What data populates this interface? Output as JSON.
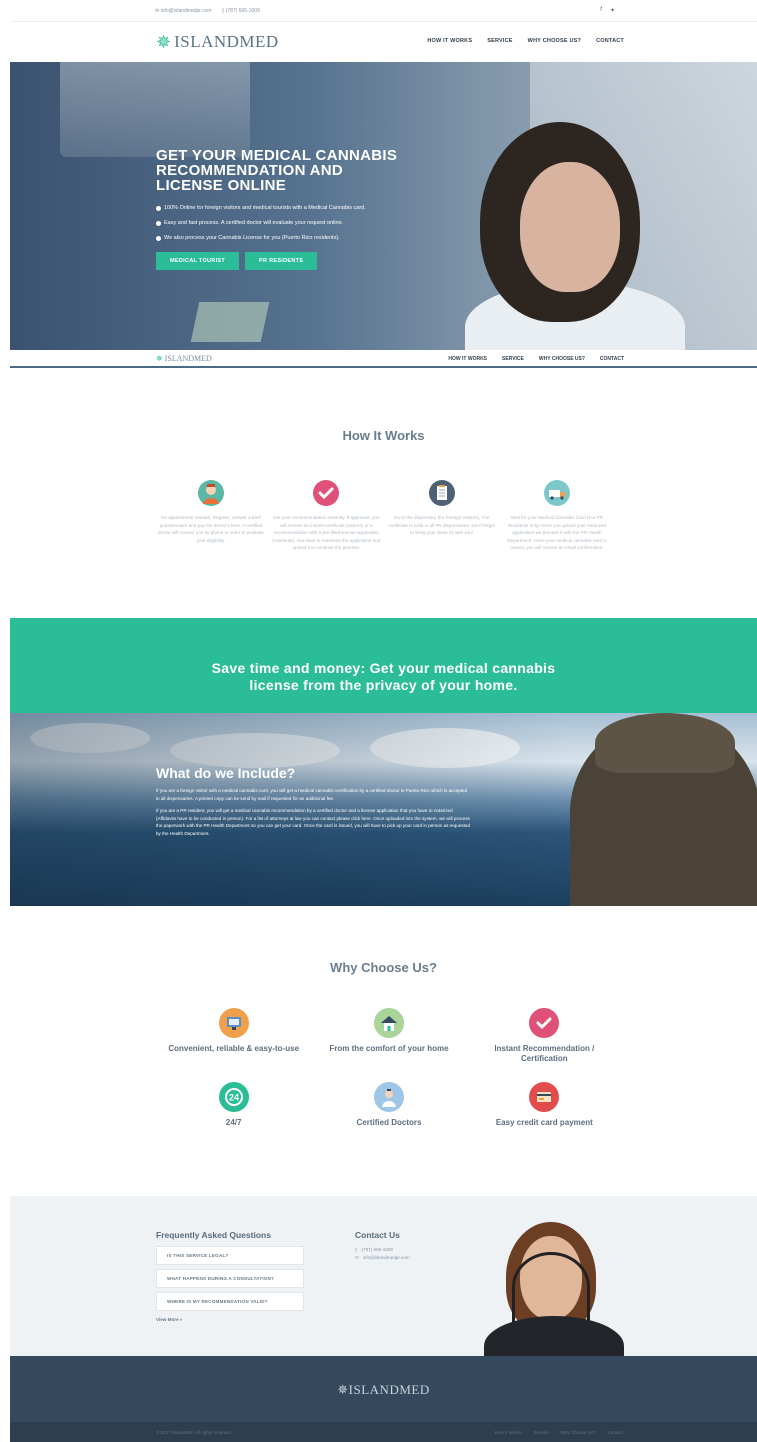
{
  "topbar": {
    "email": "info@islandmedpr.com",
    "phone": "(787) 665-1009",
    "social": [
      "f",
      "❧"
    ]
  },
  "header": {
    "logo_text": "ISLANDMED",
    "nav": [
      "HOW IT WORKS",
      "SERVICE",
      "WHY CHOOSE US?",
      "CONTACT"
    ]
  },
  "hero": {
    "title_lines": [
      "GET YOUR MEDICAL CANNABIS",
      "RECOMMENDATION AND",
      "LICENSE ONLINE"
    ],
    "bullets": [
      "100% Online for foreign visitors and medical tourists with a Medical Cannabis card.",
      "Easy and fast process. A certified doctor will evaluate your request online.",
      "We also process your Cannabis License for you (Puerto Rico residents)."
    ],
    "buttons": [
      "MEDICAL TOURIST",
      "PR RESIDENTS"
    ]
  },
  "sticky": {
    "logo_text": "ISLANDMED",
    "nav": [
      "HOW IT WORKS",
      "SERVICE",
      "WHY CHOOSE US?",
      "CONTACT"
    ]
  },
  "how": {
    "title": "How It Works",
    "steps": [
      {
        "icon": "doctor-icon",
        "color": "#5bb7a6",
        "text": "No appointment needed. Register, answer a brief questionnaire and pay the doctor's fees. A certified doctor will contact you by phone in order to evaluate your eligibility."
      },
      {
        "icon": "checkmark-icon",
        "color": "#e0517a",
        "text": "Get your recommendation instantly. If approved, you will receive an instant certificate (visitors) or a recommendation with a pre-filled license application (residents). You have to notarized the application and upload it to continue the process."
      },
      {
        "icon": "clipboard-icon",
        "color": "#4d6277",
        "text": "Go to the dispensary (for Foreign Visitors). The certificate is valid in all PR dispensaries. Don't forget to bring your State ID with you!"
      },
      {
        "icon": "delivery-truck-icon",
        "color": "#7cc7c9",
        "text": "Wait for your Medical Cannabis Card (For PR Residents only) Once you upload your notarized application we process it with the PR Health Department. Once your medical cannabis card is issued, you will receive an email confirmation."
      }
    ]
  },
  "banner": {
    "line1": "Save time and money: Get your medical cannabis",
    "line2": "license from the privacy of your home."
  },
  "include": {
    "title": "What do we Include?",
    "p1": "If you are a foreign visitor with a medical cannabis card, you will get a medical cannabis certification by a certified doctor in Puerto Rico which is accepted in all dispensaries. A printed copy can be send by mail if requested for an additional fee.",
    "p2": "If you are a PR resident, you will get a medical cannabis recommendation by a certified doctor and a license application that you have to notarized (Affidavits have to be conducted in person). For a list of attorneys at law you can contact please click here. Once uploaded into the system, we will process the paperwork with the PR Health Department so you can get your card. Once the card is issued, you will have to pick up your card in person as requested by the Health Department."
  },
  "why": {
    "title": "Why Choose Us?",
    "features": [
      {
        "icon": "monitor-icon",
        "color": "#f0a04b",
        "label": "Convenient, reliable & easy-to-use"
      },
      {
        "icon": "home-icon",
        "color": "#a9d49a",
        "label": "From the comfort of your home"
      },
      {
        "icon": "checkmark-icon",
        "color": "#e0517a",
        "label": "Instant Recommendation / Certification"
      },
      {
        "icon": "clock-24-icon",
        "color": "#2bbd98",
        "label": "24/7"
      },
      {
        "icon": "doctor-icon",
        "color": "#9ec6e6",
        "label": "Certified Doctors"
      },
      {
        "icon": "credit-card-icon",
        "color": "#e24c4c",
        "label": "Easy credit card payment"
      }
    ]
  },
  "faq": {
    "title": "Frequently Asked Questions",
    "items": [
      "IS THIS SERVICE LEGAL?",
      "WHAT HAPPENS DURING A CONSULTATION?",
      "WHERE IS MY RECOMMENDATION VALID?"
    ],
    "view_more": "View More »"
  },
  "contact": {
    "title": "Contact Us",
    "phone": "(787) 665-1009",
    "email": "info@islandmedpr.com"
  },
  "footer": {
    "logo_text": "ISLANDMED",
    "copyright": "© 2017 IslandMed. All rights reserved.",
    "nav": [
      "How It Works",
      "Service",
      "Why Choose Us?",
      "Contact"
    ]
  },
  "colors": {
    "accent": "#2bbd98",
    "dark": "#34495e"
  }
}
